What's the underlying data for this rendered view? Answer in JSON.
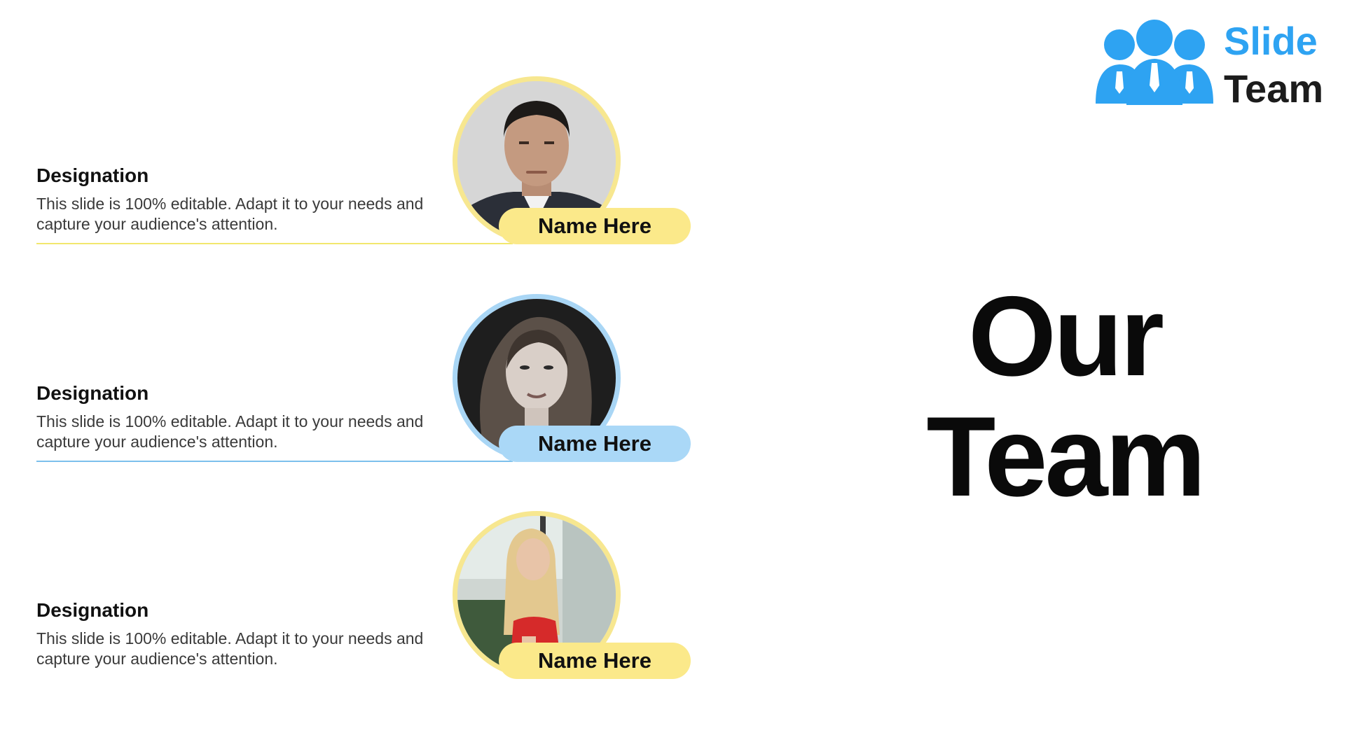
{
  "logo": {
    "word1": "Slide",
    "word2": "Team",
    "colors": {
      "icon": "#2ea3f2",
      "word1": "#2ea3f2",
      "word2": "#1c1c1c"
    }
  },
  "title": {
    "line1": "Our",
    "line2": "Team"
  },
  "members": [
    {
      "designation": "Designation",
      "description": "This slide is 100% editable. Adapt it to your needs and capture your audience's attention.",
      "name": "Name Here",
      "accent": "yellow",
      "photo": "man-portrait-photo"
    },
    {
      "designation": "Designation",
      "description": "This slide is 100% editable. Adapt it to your needs and capture your audience's attention.",
      "name": "Name Here",
      "accent": "blue",
      "photo": "woman-portrait-photo"
    },
    {
      "designation": "Designation",
      "description": "This slide is 100% editable. Adapt it to your needs and capture your audience's attention.",
      "name": "Name Here",
      "accent": "yellow",
      "photo": "woman-red-dress-photo"
    }
  ],
  "colors": {
    "yellow_accent": "#fbe98a",
    "blue_accent": "#aad8f7",
    "yellow_line": "#f2e76e",
    "blue_line": "#7cc0ec"
  }
}
